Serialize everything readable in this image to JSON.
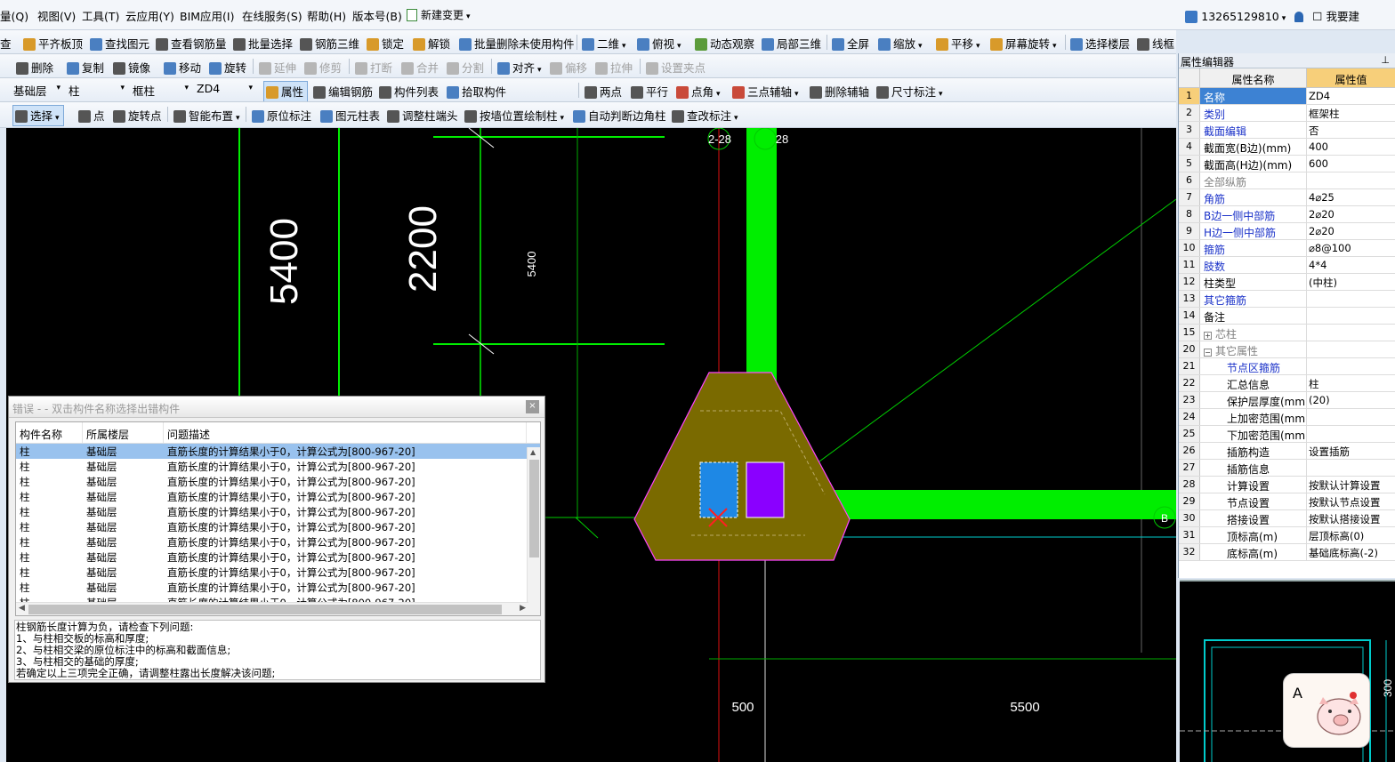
{
  "menubar": {
    "items": [
      "量(Q)",
      "视图(V)",
      "工具(T)",
      "云应用(Y)",
      "BIM应用(I)",
      "在线服务(S)",
      "帮助(H)",
      "版本号(B)"
    ],
    "new_change": "新建变更",
    "user_phone": "13265129810",
    "feedback": "我要建"
  },
  "toolbar1": {
    "items": [
      "查",
      "平齐板顶",
      "查找图元",
      "查看钢筋量",
      "批量选择",
      "钢筋三维",
      "锁定",
      "解锁",
      "批量删除未使用构件",
      "二维",
      "俯视",
      "动态观察",
      "局部三维",
      "全屏",
      "缩放",
      "平移",
      "屏幕旋转",
      "选择楼层",
      "线框"
    ]
  },
  "toolbar2": {
    "items": [
      "删除",
      "复制",
      "镜像",
      "移动",
      "旋转",
      "延伸",
      "修剪",
      "打断",
      "合并",
      "分割",
      "对齐",
      "偏移",
      "拉伸",
      "设置夹点"
    ]
  },
  "toolbar3": {
    "floor": "基础层",
    "category": "柱",
    "type": "框柱",
    "component": "ZD4",
    "items": [
      "属性",
      "编辑钢筋",
      "构件列表",
      "拾取构件",
      "两点",
      "平行",
      "点角",
      "三点辅轴",
      "删除辅轴",
      "尺寸标注"
    ]
  },
  "toolbar4": {
    "items": [
      "选择",
      "点",
      "旋转点",
      "智能布置",
      "原位标注",
      "图元柱表",
      "调整柱端头",
      "按墙位置绘制柱",
      "自动判断边角柱",
      "查改标注"
    ]
  },
  "canvas": {
    "dim_5400_large": "5400",
    "dim_2200": "2200",
    "dim_5400_small": "5400",
    "axis_label_1": "2-28",
    "axis_label_2": "28",
    "dim_500": "500",
    "dim_5500": "5500",
    "axis_b": "B",
    "colors": {
      "background": "#000000",
      "beam": "#00ff00",
      "cap": "#7a6a00",
      "col_blue": "#1e88e5",
      "col_purple": "#8a00ff"
    }
  },
  "property_editor": {
    "title": "属性编辑器",
    "col_name": "属性名称",
    "col_value": "属性值",
    "rows": [
      {
        "no": "1",
        "name": "名称",
        "value": "ZD4",
        "style": "blue",
        "sel": true
      },
      {
        "no": "2",
        "name": "类别",
        "value": "框架柱",
        "style": "blue"
      },
      {
        "no": "3",
        "name": "截面编辑",
        "value": "否",
        "style": "blue"
      },
      {
        "no": "4",
        "name": "截面宽(B边)(mm)",
        "value": "400",
        "style": ""
      },
      {
        "no": "5",
        "name": "截面高(H边)(mm)",
        "value": "600",
        "style": ""
      },
      {
        "no": "6",
        "name": "全部纵筋",
        "value": "",
        "style": "gray"
      },
      {
        "no": "7",
        "name": "角筋",
        "value": "4⌀25",
        "style": "blue"
      },
      {
        "no": "8",
        "name": "B边一侧中部筋",
        "value": "2⌀20",
        "style": "blue"
      },
      {
        "no": "9",
        "name": "H边一侧中部筋",
        "value": "2⌀20",
        "style": "blue"
      },
      {
        "no": "10",
        "name": "箍筋",
        "value": "⌀8@100",
        "style": "blue"
      },
      {
        "no": "11",
        "name": "肢数",
        "value": "4*4",
        "style": "blue"
      },
      {
        "no": "12",
        "name": "柱类型",
        "value": "(中柱)",
        "style": ""
      },
      {
        "no": "13",
        "name": "其它箍筋",
        "value": "",
        "style": "blue"
      },
      {
        "no": "14",
        "name": "备注",
        "value": "",
        "style": ""
      },
      {
        "no": "15",
        "name": "芯柱",
        "value": "",
        "style": "gray",
        "tree": "+"
      },
      {
        "no": "20",
        "name": "其它属性",
        "value": "",
        "style": "gray",
        "tree": "−"
      },
      {
        "no": "21",
        "name": "节点区箍筋",
        "value": "",
        "style": "blue indent2"
      },
      {
        "no": "22",
        "name": "汇总信息",
        "value": "柱",
        "style": "indent2"
      },
      {
        "no": "23",
        "name": "保护层厚度(mm)",
        "value": "(20)",
        "style": "indent2"
      },
      {
        "no": "24",
        "name": "上加密范围(mm)",
        "value": "",
        "style": "indent2"
      },
      {
        "no": "25",
        "name": "下加密范围(mm)",
        "value": "",
        "style": "indent2"
      },
      {
        "no": "26",
        "name": "插筋构造",
        "value": "设置插筋",
        "style": "indent2"
      },
      {
        "no": "27",
        "name": "插筋信息",
        "value": "",
        "style": "indent2"
      },
      {
        "no": "28",
        "name": "计算设置",
        "value": "按默认计算设置",
        "style": "indent2"
      },
      {
        "no": "29",
        "name": "节点设置",
        "value": "按默认节点设置",
        "style": "indent2"
      },
      {
        "no": "30",
        "name": "搭接设置",
        "value": "按默认搭接设置",
        "style": "indent2"
      },
      {
        "no": "31",
        "name": "顶标高(m)",
        "value": "层顶标高(0)",
        "style": "indent2"
      },
      {
        "no": "32",
        "name": "底标高(m)",
        "value": "基础底标高(-2)",
        "style": "indent2"
      }
    ]
  },
  "preview": {
    "dim": "300"
  },
  "error_dialog": {
    "title": "错误 - - 双击构件名称选择出错构件",
    "close": "×",
    "col_name": "构件名称",
    "col_floor": "所属楼层",
    "col_desc": "问题描述",
    "rows": [
      {
        "name": "柱",
        "floor": "基础层",
        "desc": "直筋长度的计算结果小于0，计算公式为[800-967-20]"
      },
      {
        "name": "柱",
        "floor": "基础层",
        "desc": "直筋长度的计算结果小于0，计算公式为[800-967-20]"
      },
      {
        "name": "柱",
        "floor": "基础层",
        "desc": "直筋长度的计算结果小于0，计算公式为[800-967-20]"
      },
      {
        "name": "柱",
        "floor": "基础层",
        "desc": "直筋长度的计算结果小于0，计算公式为[800-967-20]"
      },
      {
        "name": "柱",
        "floor": "基础层",
        "desc": "直筋长度的计算结果小于0，计算公式为[800-967-20]"
      },
      {
        "name": "柱",
        "floor": "基础层",
        "desc": "直筋长度的计算结果小于0，计算公式为[800-967-20]"
      },
      {
        "name": "柱",
        "floor": "基础层",
        "desc": "直筋长度的计算结果小于0，计算公式为[800-967-20]"
      },
      {
        "name": "柱",
        "floor": "基础层",
        "desc": "直筋长度的计算结果小于0，计算公式为[800-967-20]"
      },
      {
        "name": "柱",
        "floor": "基础层",
        "desc": "直筋长度的计算结果小于0，计算公式为[800-967-20]"
      },
      {
        "name": "柱",
        "floor": "基础层",
        "desc": "直筋长度的计算结果小于0，计算公式为[800-967-20]"
      },
      {
        "name": "柱",
        "floor": "基础层",
        "desc": "直筋长度的计算结果小于0，计算公式为[800-967-20]"
      }
    ],
    "help_lines": [
      "柱钢筋长度计算为负，请检查下列问题:",
      "1、与柱相交板的标高和厚度;",
      "2、与柱相交梁的原位标注中的标高和截面信息;",
      "3、与柱相交的基础的厚度;",
      "若确定以上三项完全正确，请调整柱露出长度解决该问题;"
    ]
  },
  "mascot": {
    "letter": "A"
  }
}
